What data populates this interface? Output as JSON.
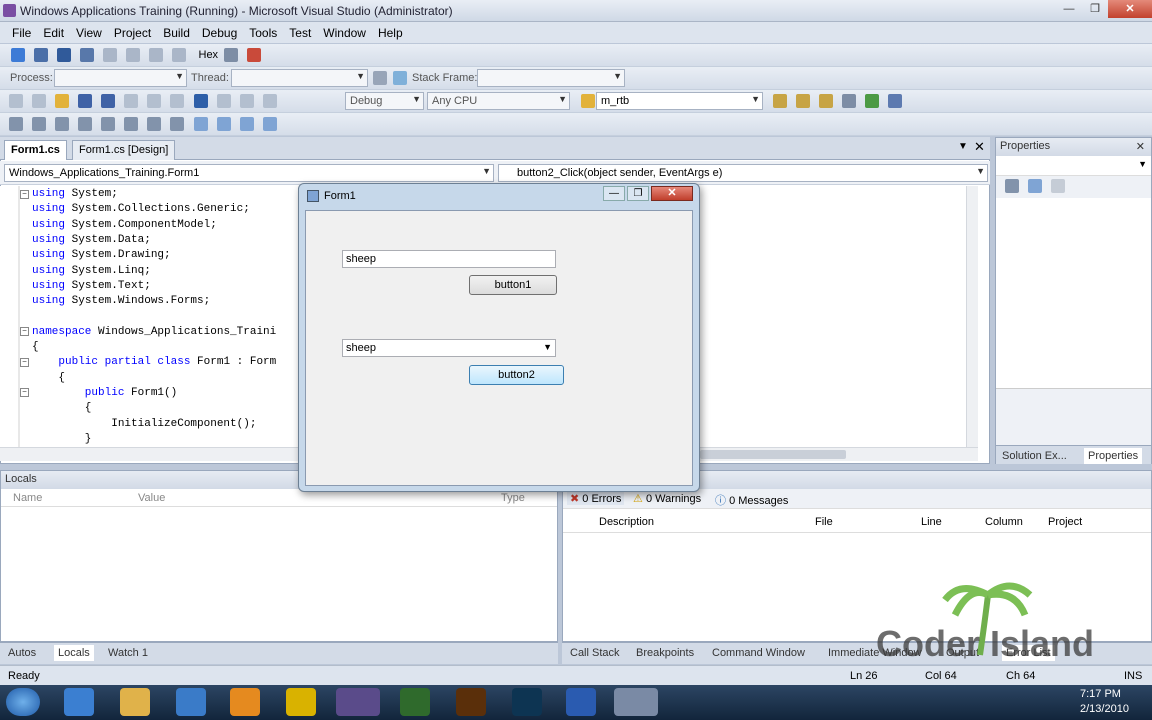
{
  "window": {
    "title": "Windows Applications Training (Running) - Microsoft Visual Studio (Administrator)"
  },
  "menu": [
    "File",
    "Edit",
    "View",
    "Project",
    "Build",
    "Debug",
    "Tools",
    "Test",
    "Window",
    "Help"
  ],
  "toolbar1": {
    "hex_label": "Hex"
  },
  "toolbar2": {
    "process_label": "Process:",
    "thread_label": "Thread:",
    "stack_label": "Stack Frame:"
  },
  "toolbar3": {
    "config": "Debug",
    "platform": "Any CPU",
    "find_text": "m_rtb"
  },
  "doc_tabs": [
    {
      "label": "Form1.cs"
    },
    {
      "label": "Form1.cs [Design]"
    }
  ],
  "nav": {
    "class_combo": "Windows_Applications_Training.Form1",
    "member_combo": "button2_Click(object sender, EventArgs e)"
  },
  "code_lines": [
    {
      "kw": "using",
      "rest": " System;"
    },
    {
      "kw": "using",
      "rest": " System.Collections.Generic;"
    },
    {
      "kw": "using",
      "rest": " System.ComponentModel;"
    },
    {
      "kw": "using",
      "rest": " System.Data;"
    },
    {
      "kw": "using",
      "rest": " System.Drawing;"
    },
    {
      "kw": "using",
      "rest": " System.Linq;"
    },
    {
      "kw": "using",
      "rest": " System.Text;"
    },
    {
      "kw": "using",
      "rest": " System.Windows.Forms;"
    },
    {
      "kw": "",
      "rest": ""
    },
    {
      "kw": "namespace",
      "rest": " Windows_Applications_Traini"
    },
    {
      "kw": "",
      "rest": "{"
    },
    {
      "kw": "    public partial class",
      "rest": " Form1 : Form"
    },
    {
      "kw": "",
      "rest": "    {"
    },
    {
      "kw": "        public",
      "rest": " Form1()"
    },
    {
      "kw": "",
      "rest": "        {"
    },
    {
      "kw": "",
      "rest": "            InitializeComponent();"
    },
    {
      "kw": "",
      "rest": "        }"
    }
  ],
  "properties": {
    "title": "Properties"
  },
  "locals": {
    "title": "Locals",
    "col_name": "Name",
    "col_value": "Value",
    "col_type": "Type"
  },
  "errors": {
    "errors": "0 Errors",
    "warnings": "0 Warnings",
    "messages": "0 Messages",
    "columns": [
      "Description",
      "File",
      "Line",
      "Column",
      "Project"
    ]
  },
  "bottom_left_tabs": [
    "Autos",
    "Locals",
    "Watch 1"
  ],
  "bottom_right_tabs": [
    "Call Stack",
    "Breakpoints",
    "Command Window",
    "Immediate Window",
    "Output",
    "Error List"
  ],
  "props_tabs": [
    "Solution Ex...",
    "Properties"
  ],
  "status": {
    "ready": "Ready",
    "ln": "Ln 26",
    "col": "Col 64",
    "ch": "Ch 64",
    "ins": "INS"
  },
  "clock": {
    "time": "7:17 PM",
    "date": "2/13/2010"
  },
  "form": {
    "title": "Form1",
    "textbox_value": "sheep",
    "button1_label": "button1",
    "combo_value": "sheep",
    "button2_label": "button2"
  },
  "watermark": {
    "text": "Coder Island"
  }
}
